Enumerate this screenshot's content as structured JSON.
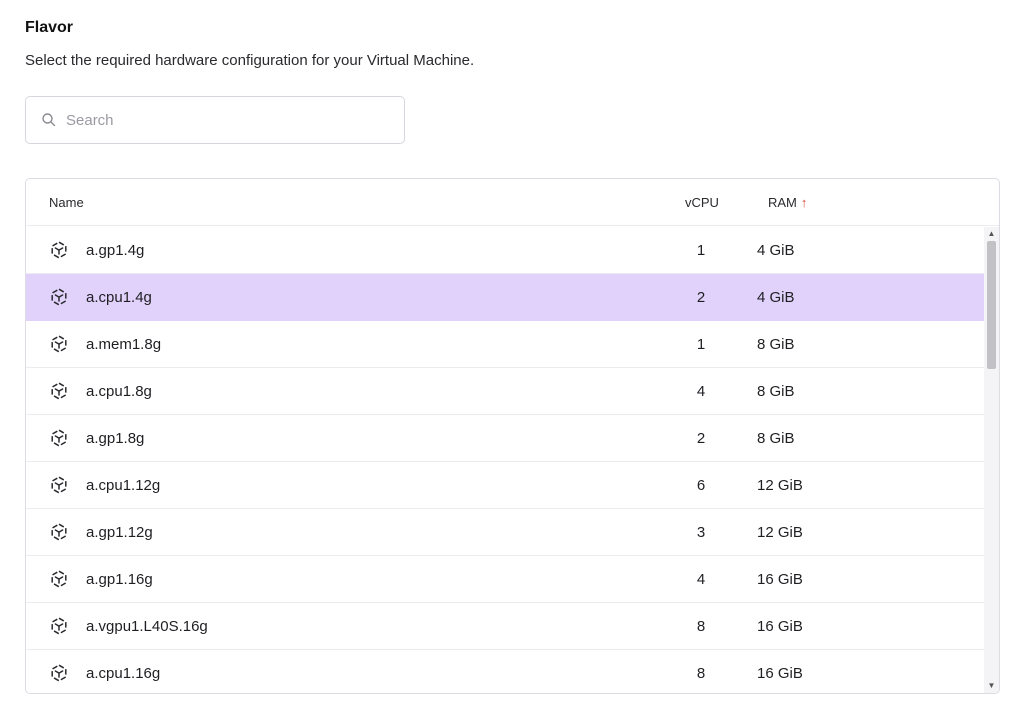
{
  "section": {
    "title": "Flavor",
    "description": "Select the required hardware configuration for your Virtual Machine."
  },
  "search": {
    "placeholder": "Search",
    "value": "",
    "icon": "search-icon"
  },
  "table": {
    "columns": {
      "name": "Name",
      "vcpu": "vCPU",
      "ram": "RAM",
      "ram_sort_indicator": "↑"
    },
    "row_icon": "flavor-cube-icon",
    "selected_color": "#e1d2fb",
    "sort_accent": "#e04a3a",
    "rows": [
      {
        "name": "a.gp1.4g",
        "vcpu": "1",
        "ram": "4 GiB"
      },
      {
        "name": "a.cpu1.4g",
        "vcpu": "2",
        "ram": "4 GiB"
      },
      {
        "name": "a.mem1.8g",
        "vcpu": "1",
        "ram": "8 GiB"
      },
      {
        "name": "a.cpu1.8g",
        "vcpu": "4",
        "ram": "8 GiB"
      },
      {
        "name": "a.gp1.8g",
        "vcpu": "2",
        "ram": "8 GiB"
      },
      {
        "name": "a.cpu1.12g",
        "vcpu": "6",
        "ram": "12 GiB"
      },
      {
        "name": "a.gp1.12g",
        "vcpu": "3",
        "ram": "12 GiB"
      },
      {
        "name": "a.gp1.16g",
        "vcpu": "4",
        "ram": "16 GiB"
      },
      {
        "name": "a.vgpu1.L40S.16g",
        "vcpu": "8",
        "ram": "16 GiB"
      },
      {
        "name": "a.cpu1.16g",
        "vcpu": "8",
        "ram": "16 GiB"
      }
    ]
  }
}
